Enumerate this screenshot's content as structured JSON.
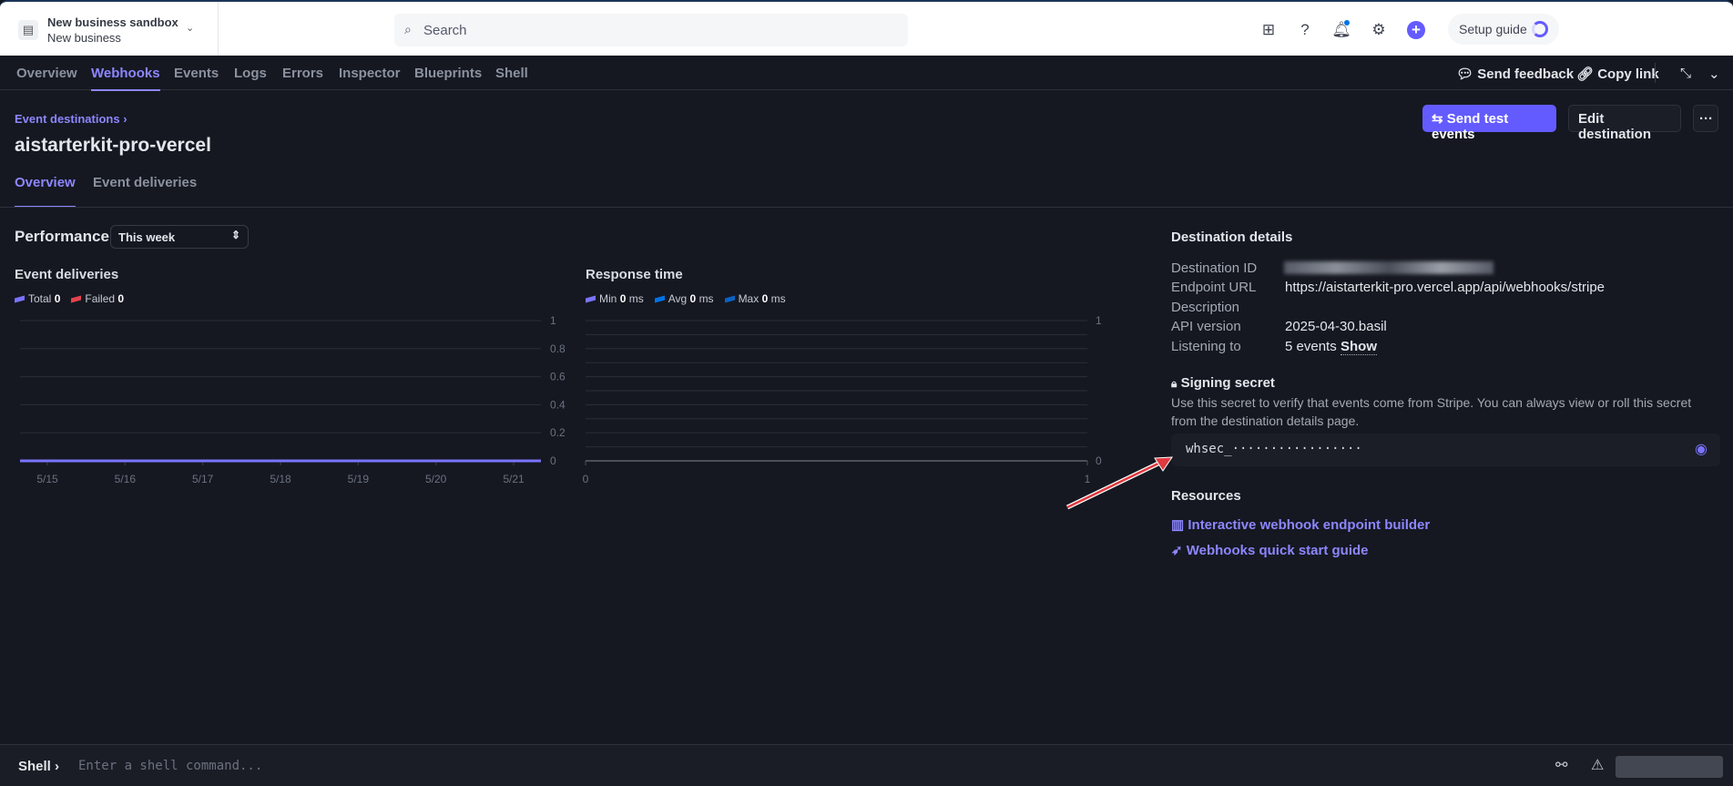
{
  "account": {
    "name": "New business sandbox",
    "sub": "New business"
  },
  "search": {
    "placeholder": "Search"
  },
  "top": {
    "setup_guide": "Setup guide"
  },
  "nav": {
    "tabs": [
      "Overview",
      "Webhooks",
      "Events",
      "Logs",
      "Errors",
      "Inspector",
      "Blueprints",
      "Shell"
    ],
    "active": "Webhooks",
    "send_feedback": "Send feedback",
    "copy_link": "Copy link"
  },
  "page": {
    "breadcrumb": "Event destinations",
    "title": "aistarterkit-pro-vercel",
    "send_test": "Send test events",
    "edit": "Edit destination",
    "more": "···",
    "subtabs": [
      "Overview",
      "Event deliveries"
    ]
  },
  "performance": {
    "title": "Performance",
    "range": "This week"
  },
  "colors": {
    "accent": "#635bff",
    "total": "#7a73ff",
    "failed": "#e5424d",
    "avg": "#0073e6",
    "max": "#0a62c4"
  },
  "chart_data": [
    {
      "type": "line",
      "title": "Event deliveries",
      "categories": [
        "5/15",
        "5/16",
        "5/17",
        "5/18",
        "5/19",
        "5/20",
        "5/21"
      ],
      "series": [
        {
          "name": "Total",
          "value_label": "0",
          "values": [
            0,
            0,
            0,
            0,
            0,
            0,
            0
          ]
        },
        {
          "name": "Failed",
          "value_label": "0",
          "values": [
            0,
            0,
            0,
            0,
            0,
            0,
            0
          ]
        }
      ],
      "yticks": [
        "0",
        "0.2",
        "0.4",
        "0.6",
        "0.8",
        "1"
      ],
      "ylim": [
        0,
        1
      ]
    },
    {
      "type": "line",
      "title": "Response time",
      "series": [
        {
          "name": "Min",
          "value": "0",
          "unit": "ms"
        },
        {
          "name": "Avg",
          "value": "0",
          "unit": "ms"
        },
        {
          "name": "Max",
          "value": "0",
          "unit": "ms"
        }
      ],
      "xticks": [
        "0",
        "1"
      ],
      "yticks": [
        "0",
        "1"
      ],
      "ylim": [
        0,
        1
      ]
    }
  ],
  "details": {
    "title": "Destination details",
    "rows": [
      {
        "label": "Destination ID",
        "value": ""
      },
      {
        "label": "Endpoint URL",
        "value": "https://aistarterkit-pro.vercel.app/api/webhooks/stripe"
      },
      {
        "label": "Description",
        "value": ""
      },
      {
        "label": "API version",
        "value": "2025-04-30.basil"
      },
      {
        "label": "Listening to",
        "value": "5 events"
      }
    ],
    "show": "Show"
  },
  "secret": {
    "title": "Signing secret",
    "desc1": "Use this secret to verify that events come from Stripe. You can always view or roll this secret",
    "desc2": "from the destination details page.",
    "value": "whsec_·················"
  },
  "resources": {
    "title": "Resources",
    "links": [
      "Interactive webhook endpoint builder",
      "Webhooks quick start guide"
    ]
  },
  "shell": {
    "label": "Shell",
    "placeholder": "Enter a shell command..."
  }
}
